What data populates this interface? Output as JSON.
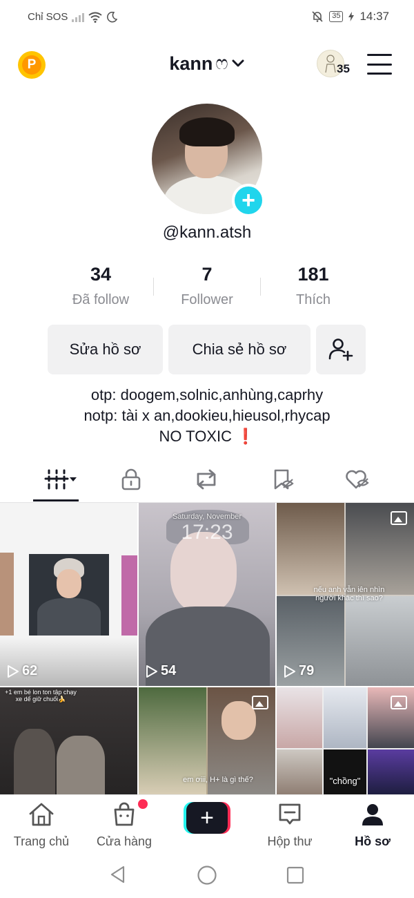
{
  "status_bar": {
    "carrier": "Chỉ SOS",
    "battery": "35",
    "time": "14:37"
  },
  "header": {
    "username_title": "kann",
    "username_symbol": "ෆ",
    "story_count": "35"
  },
  "profile": {
    "handle": "@kann.atsh",
    "stats": [
      {
        "value": "34",
        "label": "Đã follow"
      },
      {
        "value": "7",
        "label": "Follower"
      },
      {
        "value": "181",
        "label": "Thích"
      }
    ],
    "edit_button": "Sửa hồ sơ",
    "share_button": "Chia sẻ hồ sơ",
    "bio": {
      "line1": "otp: doogem,solnic,anhùng,caprhy",
      "line2": "notp: tài x an,dookieu,hieusol,rhycap",
      "line3": "NO TOXIC",
      "line3_mark": "❗"
    }
  },
  "tabs": [
    "videos",
    "private",
    "reposts",
    "favorites",
    "liked"
  ],
  "grid": {
    "items": [
      {
        "type": "video",
        "views": "62"
      },
      {
        "type": "video",
        "views": "54",
        "overlay_date": "Saturday, November",
        "overlay_time": "17:23"
      },
      {
        "type": "video",
        "views": "79",
        "caption": "nếu anh vẫn iên nhìn người khác thì sao?"
      },
      {
        "type": "video",
        "caption": "+1 em bé lon ton tập chạy xe dể giữ chuối🍌"
      },
      {
        "type": "photo",
        "caption": "em ơiii, H+ là gì thế?"
      },
      {
        "type": "photo",
        "caption": "\"chồng\""
      }
    ]
  },
  "bottom_nav": [
    {
      "label": "Trang chủ",
      "icon": "home-icon"
    },
    {
      "label": "Cửa hàng",
      "icon": "shop-icon"
    },
    {
      "label": "",
      "icon": "create-icon"
    },
    {
      "label": "Hộp thư",
      "icon": "inbox-icon"
    },
    {
      "label": "Hồ sơ",
      "icon": "profile-icon"
    }
  ],
  "colors": {
    "accent_cyan": "#20d5ec",
    "accent_red": "#fe2c55",
    "coin": "#ffc400"
  }
}
